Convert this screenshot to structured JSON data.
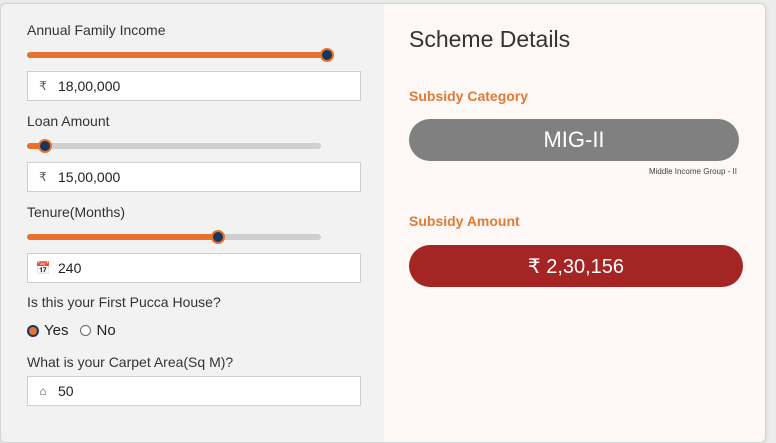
{
  "form": {
    "income": {
      "label": "Annual Family Income",
      "currency_icon": "rupee-icon",
      "currency_glyph": "₹",
      "value": "18,00,000",
      "slider_level": 1.0
    },
    "loan": {
      "label": "Loan Amount",
      "currency_icon": "rupee-icon",
      "currency_glyph": "₹",
      "value": "15,00,000",
      "slider_level": 0.06
    },
    "tenure": {
      "label": "Tenure(Months)",
      "icon": "calendar-icon",
      "value": "240",
      "slider_level": 0.65
    },
    "first_house": {
      "label": "Is this your First Pucca House?",
      "yes": "Yes",
      "no": "No",
      "selected": "Yes"
    },
    "carpet": {
      "label": "What is your Carpet Area(Sq M)?",
      "icon": "home-icon",
      "value": "50"
    }
  },
  "scheme": {
    "title": "Scheme Details",
    "category_label": "Subsidy Category",
    "category_value": "MIG-II",
    "category_desc": "Middle Income Group - II",
    "amount_label": "Subsidy Amount",
    "amount_value": "₹ 2,30,156"
  },
  "colors": {
    "accent": "#e8712d",
    "thumb": "#17365d",
    "category_pill": "#808080",
    "amount_pill": "#a52424",
    "subheading": "#e07a35"
  }
}
